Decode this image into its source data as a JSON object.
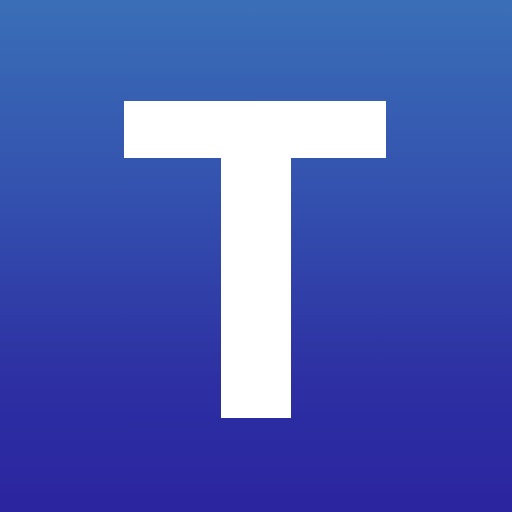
{
  "icon": {
    "letter": "T",
    "letter_color": "#ffffff",
    "background_top_color": "#3a6fb7",
    "background_bottom_color": "#2b25a0",
    "icon_name": "letter-t-logo-icon"
  }
}
